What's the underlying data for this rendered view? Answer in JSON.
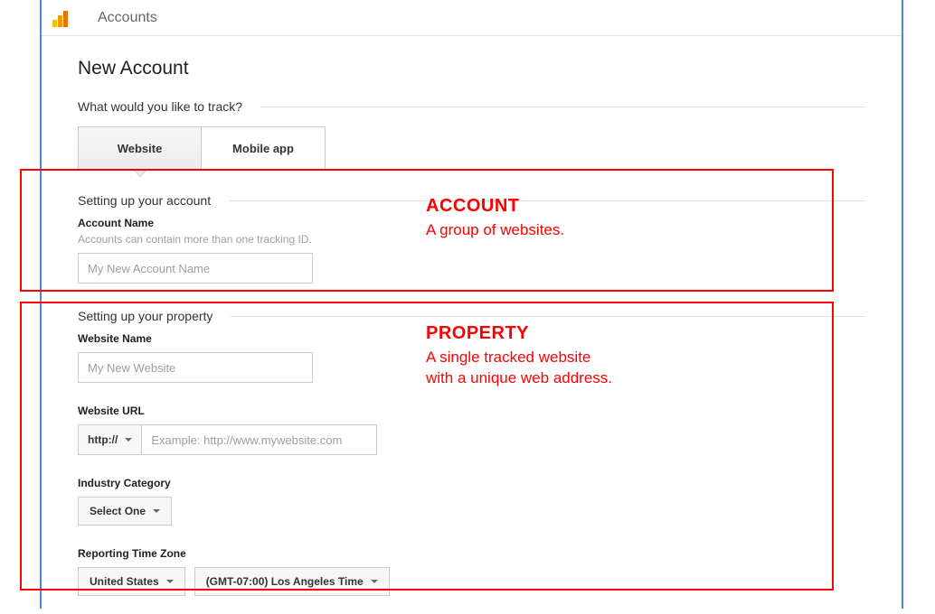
{
  "header": {
    "title": "Accounts"
  },
  "pageTitle": "New Account",
  "trackQuestion": "What would you like to track?",
  "toggles": {
    "website": "Website",
    "mobile": "Mobile app"
  },
  "account": {
    "section": "Setting up your account",
    "nameLabel": "Account Name",
    "nameHint": "Accounts can contain more than one tracking ID.",
    "namePlaceholder": "My New Account Name"
  },
  "property": {
    "section": "Setting up your property",
    "websiteNameLabel": "Website Name",
    "websiteNamePlaceholder": "My New Website",
    "urlLabel": "Website URL",
    "protocol": "http://",
    "urlPlaceholder": "Example: http://www.mywebsite.com",
    "industryLabel": "Industry Category",
    "industryValue": "Select One",
    "tzLabel": "Reporting Time Zone",
    "tzCountry": "United States",
    "tzValue": "(GMT-07:00) Los Angeles Time"
  },
  "annotations": {
    "account": {
      "title": "ACCOUNT",
      "body": "A group of websites."
    },
    "property": {
      "title": "PROPERTY",
      "body": "A single tracked website\nwith a unique web address."
    }
  }
}
